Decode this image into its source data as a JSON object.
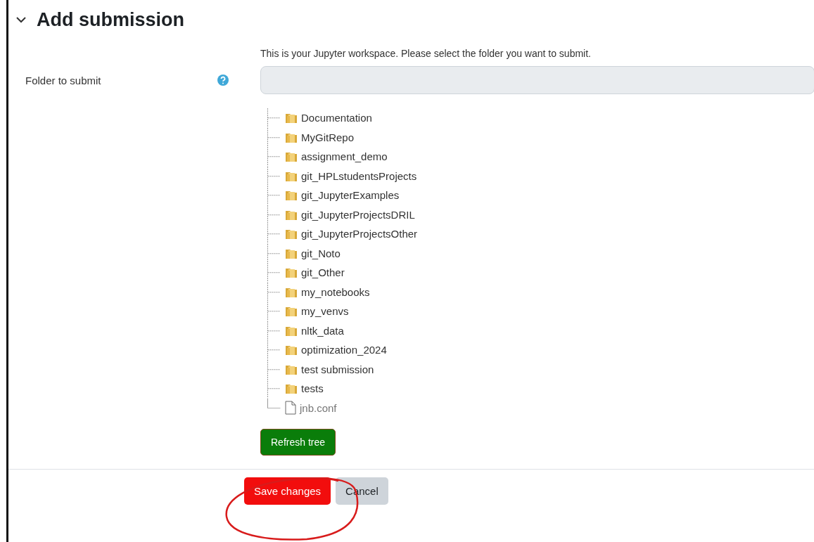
{
  "section": {
    "title": "Add submission",
    "expanded": true
  },
  "intro": "This is your Jupyter workspace. Please select the folder you want to submit.",
  "field": {
    "label": "Folder to submit"
  },
  "tree": [
    {
      "kind": "folder",
      "name": "Documentation"
    },
    {
      "kind": "folder",
      "name": "MyGitRepo"
    },
    {
      "kind": "folder",
      "name": "assignment_demo"
    },
    {
      "kind": "folder",
      "name": "git_HPLstudentsProjects"
    },
    {
      "kind": "folder",
      "name": "git_JupyterExamples"
    },
    {
      "kind": "folder",
      "name": "git_JupyterProjectsDRIL"
    },
    {
      "kind": "folder",
      "name": "git_JupyterProjectsOther"
    },
    {
      "kind": "folder",
      "name": "git_Noto"
    },
    {
      "kind": "folder",
      "name": "git_Other"
    },
    {
      "kind": "folder",
      "name": "my_notebooks"
    },
    {
      "kind": "folder",
      "name": "my_venvs"
    },
    {
      "kind": "folder",
      "name": "nltk_data"
    },
    {
      "kind": "folder",
      "name": "optimization_2024"
    },
    {
      "kind": "folder",
      "name": "test submission"
    },
    {
      "kind": "folder",
      "name": "tests"
    },
    {
      "kind": "file",
      "name": "jnb.conf"
    }
  ],
  "refresh_button": "Refresh tree",
  "actions": [
    {
      "kind": "primary",
      "label": "Save changes"
    },
    {
      "kind": "secondary",
      "label": "Cancel"
    }
  ]
}
